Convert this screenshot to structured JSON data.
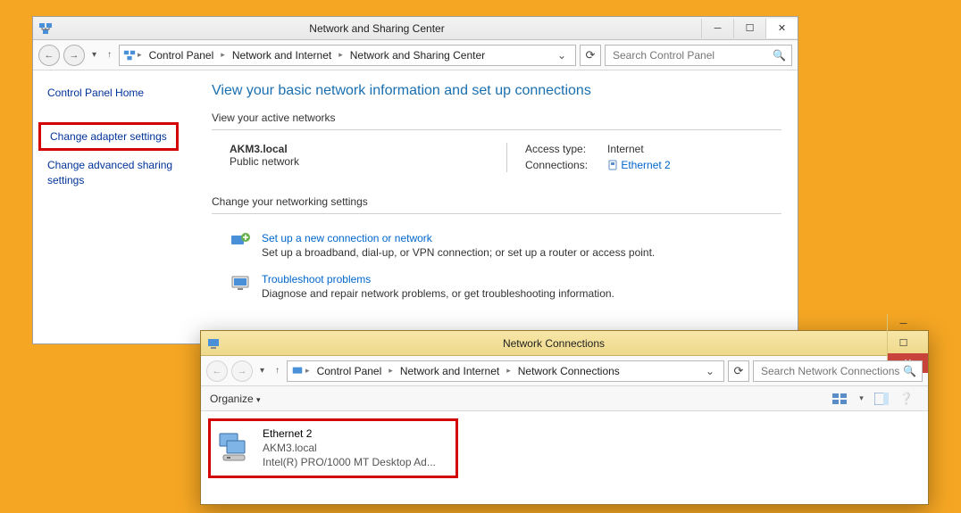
{
  "win1": {
    "title": "Network and Sharing Center",
    "breadcrumbs": [
      "Control Panel",
      "Network and Internet",
      "Network and Sharing Center"
    ],
    "search_placeholder": "Search Control Panel",
    "sidebar": {
      "home": "Control Panel Home",
      "adapter": "Change adapter settings",
      "advanced": "Change advanced sharing settings"
    },
    "heading": "View your basic network information and set up connections",
    "active_label": "View your active networks",
    "network": {
      "name": "AKM3.local",
      "type": "Public network",
      "access_label": "Access type:",
      "access_value": "Internet",
      "conn_label": "Connections:",
      "conn_value": "Ethernet 2"
    },
    "change_label": "Change your networking settings",
    "setup": {
      "link": "Set up a new connection or network",
      "desc": "Set up a broadband, dial-up, or VPN connection; or set up a router or access point."
    },
    "trouble": {
      "link": "Troubleshoot problems",
      "desc": "Diagnose and repair network problems, or get troubleshooting information."
    }
  },
  "win2": {
    "title": "Network Connections",
    "breadcrumbs": [
      "Control Panel",
      "Network and Internet",
      "Network Connections"
    ],
    "search_placeholder": "Search Network Connections",
    "organize": "Organize",
    "item": {
      "name": "Ethernet 2",
      "domain": "AKM3.local",
      "adapter": "Intel(R) PRO/1000 MT Desktop Ad..."
    }
  }
}
